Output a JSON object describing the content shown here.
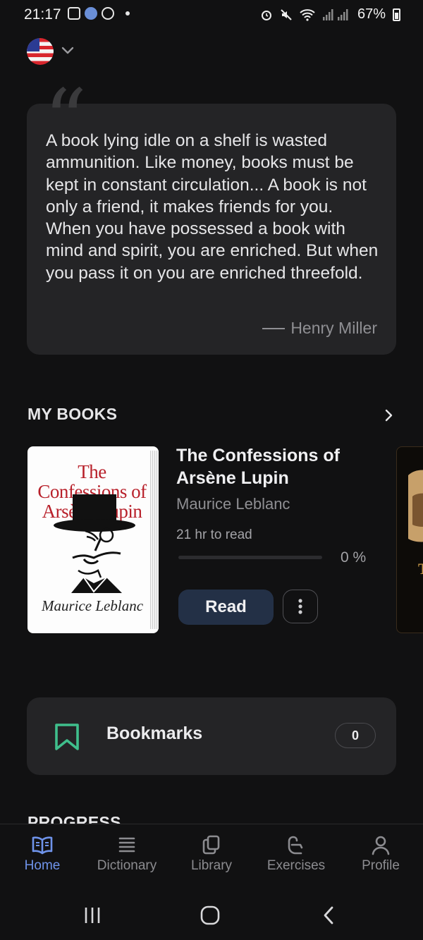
{
  "status_bar": {
    "time": "21:17",
    "battery": "67%"
  },
  "language": {
    "selected": "US English flag"
  },
  "quote": {
    "text": "A book lying idle on a shelf is wasted ammunition. Like money, books must be kept in constant circulation... A book is not only a friend, it makes friends for you. When you have possessed a book with mind and spirit, you are enriched. But when you pass it on you are enriched threefold.",
    "author": "Henry Miller"
  },
  "my_books": {
    "title": "MY BOOKS",
    "book": {
      "cover_title": "The Confessions of Arsène Lupin",
      "cover_author": "Maurice Leblanc",
      "title": "The Confessions of Arsène Lupin",
      "author": "Maurice Leblanc",
      "read_time": "21 hr to read",
      "progress_percent": 0,
      "progress_label": "0 %",
      "read_label": "Read"
    }
  },
  "bookmarks": {
    "label": "Bookmarks",
    "count": "0"
  },
  "progress_section": {
    "title": "PROGRESS"
  },
  "bottom_nav": {
    "items": [
      {
        "label": "Home",
        "icon": "book-open-icon",
        "active": true
      },
      {
        "label": "Dictionary",
        "icon": "list-icon",
        "active": false
      },
      {
        "label": "Library",
        "icon": "copy-icon",
        "active": false
      },
      {
        "label": "Exercises",
        "icon": "exercises-icon",
        "active": false
      },
      {
        "label": "Profile",
        "icon": "user-icon",
        "active": false
      }
    ]
  },
  "colors": {
    "background": "#111112",
    "card": "#242426",
    "accent": "#6f93ea",
    "read_button": "#233046",
    "bookmark_green": "#3fbf8c",
    "cover_title_red": "#b8202a"
  }
}
